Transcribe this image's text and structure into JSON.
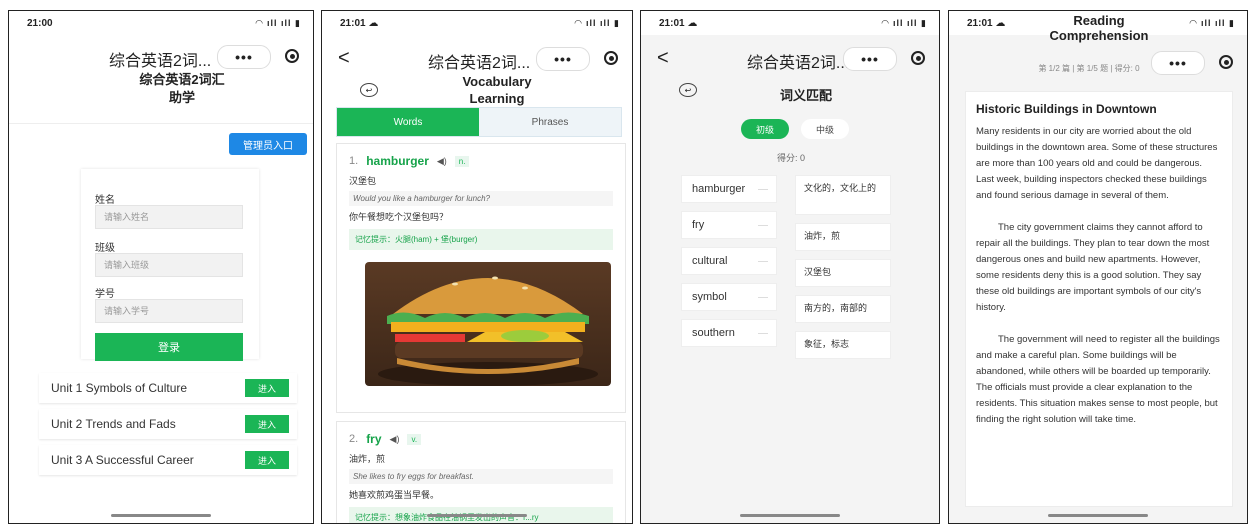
{
  "panel1": {
    "time": "21:00",
    "status_icons": "WiFi 5G 5G 79",
    "nav_title": "综合英语2词...",
    "more_label": "•••",
    "page_title_line1": "综合英语2词汇",
    "page_title_line2": "助学",
    "admin_button": "管理员入口",
    "fields": [
      {
        "label": "姓名",
        "placeholder": "请输入姓名"
      },
      {
        "label": "班级",
        "placeholder": "请输入班级"
      },
      {
        "label": "学号",
        "placeholder": "请输入学号"
      }
    ],
    "login_button": "登录",
    "units": [
      {
        "name": "Unit 1 Symbols of Culture",
        "action": "进入"
      },
      {
        "name": "Unit 2 Trends and Fads",
        "action": "进入"
      },
      {
        "name": "Unit 3 A Successful Career",
        "action": "进入"
      }
    ]
  },
  "panel2": {
    "time": "21:01",
    "status_icons": "WiFi 5G 5G 79",
    "nav_title": "综合英语2词...",
    "more_label": "•••",
    "back_arrow": "<",
    "page_title_line1": "Vocabulary",
    "page_title_line2": "Learning",
    "tabs": [
      "Words",
      "Phrases"
    ],
    "words": [
      {
        "num": "1.",
        "word": "hamburger",
        "pos": "n.",
        "meaning": "汉堡包",
        "example": "Would you like a hamburger for lunch?",
        "example_trans": "你午餐想吃个汉堡包吗？",
        "tip": "记忆提示：火腿(ham) + 堡(burger)"
      },
      {
        "num": "2.",
        "word": "fry",
        "pos": "v.",
        "meaning": "油炸，煎",
        "example": "She likes to fry eggs for breakfast.",
        "example_trans": "她喜欢煎鸡蛋当早餐。",
        "tip": "记忆提示：想象油炸食品在油锅里发出的声音：f...ry"
      }
    ]
  },
  "panel3": {
    "time": "21:01",
    "status_icons": "WiFi 5G 5G 79",
    "nav_title": "综合英语2词...",
    "more_label": "•••",
    "back_arrow": "<",
    "page_title": "词义匹配",
    "levels": [
      "初级",
      "中级"
    ],
    "score": "得分: 0",
    "left_words": [
      "hamburger",
      "fry",
      "cultural",
      "symbol",
      "southern"
    ],
    "right_meanings": [
      "文化的，文化上的",
      "油炸，煎",
      "汉堡包",
      "南方的，南部的",
      "象征，标志"
    ]
  },
  "panel4": {
    "time": "21:01",
    "status_icons": "WiFi 5G 5G 79",
    "more_label": "•••",
    "page_title_line1": "Reading",
    "page_title_line2": "Comprehension",
    "progress": "第 1/2 篇 | 第 1/5 题 | 得分: 0",
    "passage_title": "Historic Buildings in Downtown",
    "paragraphs": [
      "Many residents in our city are worried about the old buildings in the downtown area. Some of these structures are more than 100 years old and could be dangerous. Last week, building inspectors checked these buildings and found serious damage in several of them.",
      "The city government claims they cannot afford to repair all the buildings. They plan to tear down the most dangerous ones and build new apartments. However, some residents deny this is a good solution. They say these old buildings are important symbols of our city's history.",
      "The government will need to register all the buildings and make a careful plan. Some buildings will be abandoned, while others will be boarded up temporarily. The officials must provide a clear explanation to the residents. This situation makes sense to most people, but finding the right solution will take time."
    ]
  },
  "colors": {
    "primary_green": "#1bb556",
    "admin_blue": "#1e88e5"
  }
}
